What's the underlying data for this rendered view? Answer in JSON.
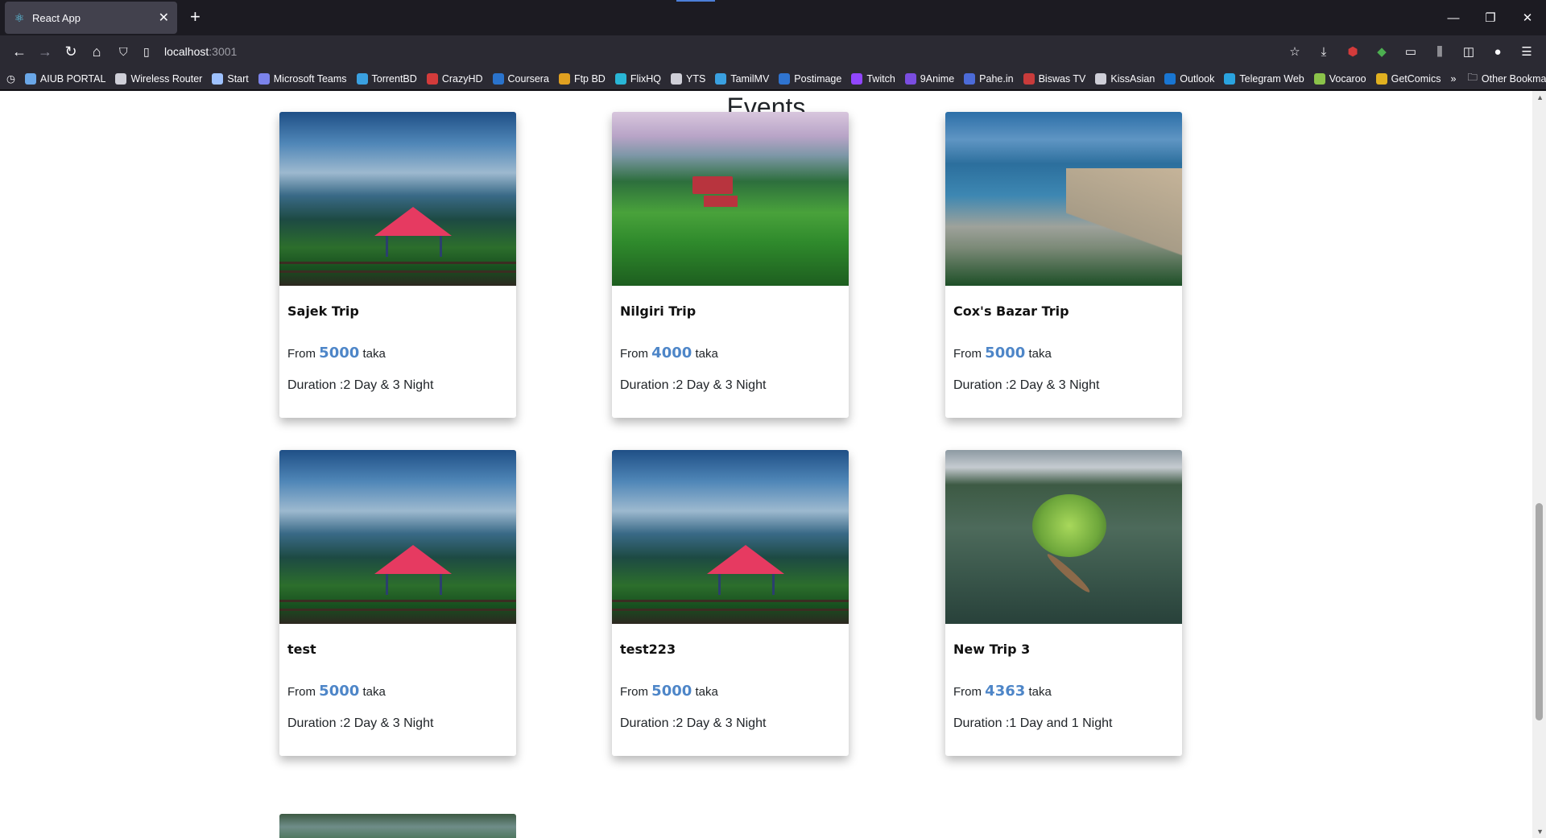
{
  "browser": {
    "tab_title": "React App",
    "url_host": "localhost",
    "url_port": ":3001",
    "bookmarks": [
      {
        "label": "AIUB PORTAL",
        "color": "#6aa7e8"
      },
      {
        "label": "Wireless Router",
        "color": "#cfcfd8"
      },
      {
        "label": "Start",
        "color": "#9ec1ff"
      },
      {
        "label": "Microsoft Teams",
        "color": "#7b83eb"
      },
      {
        "label": "TorrentBD",
        "color": "#3aa0e0"
      },
      {
        "label": "CrazyHD",
        "color": "#d33b3b"
      },
      {
        "label": "Coursera",
        "color": "#2a73cc"
      },
      {
        "label": "Ftp BD",
        "color": "#e0a020"
      },
      {
        "label": "FlixHQ",
        "color": "#29b6d6"
      },
      {
        "label": "YTS",
        "color": "#cfcfd8"
      },
      {
        "label": "TamilMV",
        "color": "#3aa0e0"
      },
      {
        "label": "Postimage",
        "color": "#2f74d0"
      },
      {
        "label": "Twitch",
        "color": "#9146ff"
      },
      {
        "label": "9Anime",
        "color": "#7a4de0"
      },
      {
        "label": "Pahe.in",
        "color": "#4c6bd8"
      },
      {
        "label": "Biswas TV",
        "color": "#c83b3b"
      },
      {
        "label": "KissAsian",
        "color": "#cfcfd8"
      },
      {
        "label": "Outlook",
        "color": "#1976d2"
      },
      {
        "label": "Telegram Web",
        "color": "#2aa3df"
      },
      {
        "label": "Vocaroo",
        "color": "#8bc34a"
      },
      {
        "label": "GetComics",
        "color": "#e0b020"
      }
    ],
    "other_bookmarks": "Other Bookmarks"
  },
  "page": {
    "heading": "Events",
    "cards": [
      {
        "name": "Sajek Trip",
        "from": "From",
        "price": "5000",
        "unit": "taka",
        "duration": "Duration :2 Day & 3 Night"
      },
      {
        "name": "Nilgiri Trip",
        "from": "From",
        "price": "4000",
        "unit": "taka",
        "duration": "Duration :2 Day & 3 Night"
      },
      {
        "name": "Cox's Bazar Trip",
        "from": "From",
        "price": "5000",
        "unit": "taka",
        "duration": "Duration :2 Day & 3 Night"
      },
      {
        "name": "test",
        "from": "From",
        "price": "5000",
        "unit": "taka",
        "duration": "Duration :2 Day & 3 Night"
      },
      {
        "name": "test223",
        "from": "From",
        "price": "5000",
        "unit": "taka",
        "duration": "Duration :2 Day & 3 Night"
      },
      {
        "name": "New Trip 3",
        "from": "From",
        "price": "4363",
        "unit": "taka",
        "duration": "Duration :1 Day and 1 Night"
      }
    ]
  },
  "colors": {
    "price_accent": "#4e86c8",
    "browser_bg": "#1c1b22",
    "toolbar_bg": "#2b2a33"
  }
}
